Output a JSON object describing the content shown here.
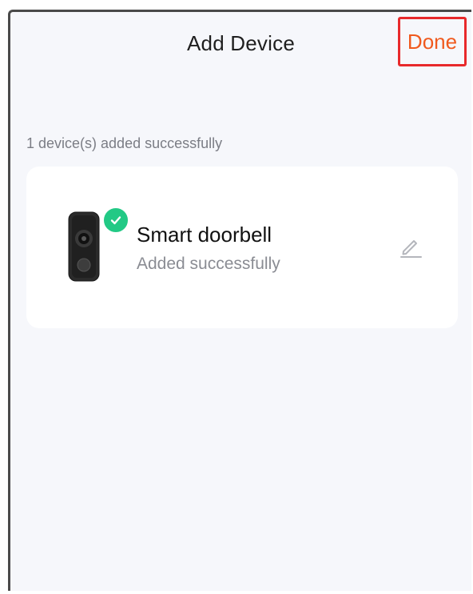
{
  "header": {
    "title": "Add Device",
    "done_label": "Done"
  },
  "status": {
    "summary": "1 device(s) added successfully"
  },
  "devices": [
    {
      "name": "Smart doorbell",
      "status": "Added successfully",
      "image_icon": "doorbell-image",
      "badge_icon": "check-circle-icon",
      "edit_icon": "pencil-icon"
    }
  ],
  "colors": {
    "done_text": "#f05a1e",
    "highlight_border": "#e8292b",
    "success_badge": "#22c985",
    "background": "#f6f7fb"
  }
}
